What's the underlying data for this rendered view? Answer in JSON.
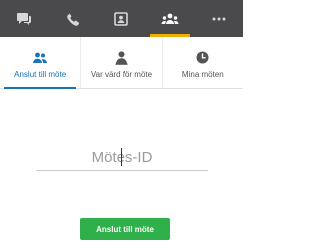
{
  "topbar": {
    "items": [
      {
        "icon": "chat-icon",
        "active": false
      },
      {
        "icon": "phone-icon",
        "active": false
      },
      {
        "icon": "contact-card-icon",
        "active": false
      },
      {
        "icon": "meetings-icon",
        "active": true
      },
      {
        "icon": "more-icon",
        "active": false
      }
    ],
    "background": "#4a4a4d",
    "active_indicator_color": "#f0b000"
  },
  "subtabs": [
    {
      "label": "Anslut till möte",
      "icon": "join-people-icon",
      "active": true
    },
    {
      "label": "Var värd för möte",
      "icon": "host-person-icon",
      "active": false
    },
    {
      "label": "Mina möten",
      "icon": "clock-icon",
      "active": false
    }
  ],
  "meeting_id": {
    "value": "",
    "placeholder": "Mötes-ID"
  },
  "join_button": {
    "label": "Anslut till möte",
    "color": "#2fb04a"
  },
  "accent_color": "#1a73b9"
}
